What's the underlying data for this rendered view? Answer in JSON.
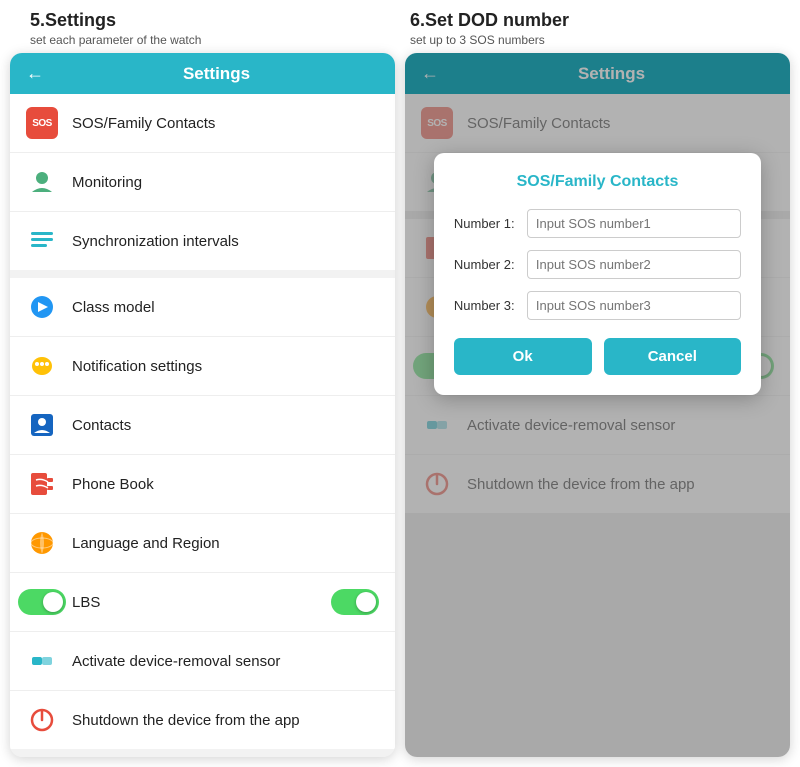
{
  "left_section": {
    "title": "5.Settings",
    "subtitle": "set each parameter of the watch"
  },
  "right_section": {
    "title": "6.Set DOD number",
    "subtitle": "set up to 3 SOS numbers"
  },
  "panel_header": {
    "title": "Settings",
    "back_arrow": "←"
  },
  "menu_items_top": [
    {
      "id": "sos",
      "label": "SOS/Family Contacts",
      "icon_type": "sos"
    },
    {
      "id": "monitoring",
      "label": "Monitoring",
      "icon_type": "monitoring"
    },
    {
      "id": "sync",
      "label": "Synchronization intervals",
      "icon_type": "sync"
    }
  ],
  "menu_items_bottom": [
    {
      "id": "class",
      "label": "Class model",
      "icon_type": "class"
    },
    {
      "id": "notification",
      "label": "Notification settings",
      "icon_type": "notif"
    },
    {
      "id": "contacts",
      "label": "Contacts",
      "icon_type": "contacts"
    },
    {
      "id": "phonebook",
      "label": "Phone Book",
      "icon_type": "phonebook"
    },
    {
      "id": "language",
      "label": "Language and Region",
      "icon_type": "language"
    },
    {
      "id": "lbs",
      "label": "LBS",
      "icon_type": "lbs",
      "toggle": true
    },
    {
      "id": "sensor",
      "label": "Activate device-removal sensor",
      "icon_type": "sensor"
    },
    {
      "id": "shutdown",
      "label": "Shutdown the device from the app",
      "icon_type": "shutdown"
    }
  ],
  "dialog": {
    "title": "SOS/Family Contacts",
    "field1_label": "Number 1:",
    "field1_placeholder": "Input SOS number1",
    "field2_label": "Number 2:",
    "field2_placeholder": "Input SOS number2",
    "field3_label": "Number 3:",
    "field3_placeholder": "Input SOS number3",
    "ok_label": "Ok",
    "cancel_label": "Cancel"
  }
}
